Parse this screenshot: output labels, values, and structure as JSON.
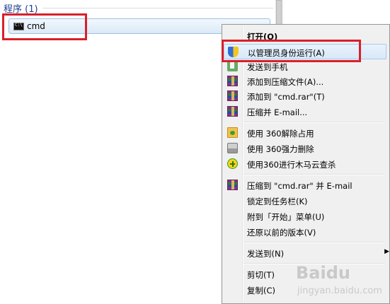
{
  "results": {
    "section_header": "程序 (1)",
    "items": [
      {
        "label": "cmd",
        "icon": "cmd-icon"
      }
    ]
  },
  "context_menu": {
    "items": [
      {
        "label": "打开(O)",
        "bold": true,
        "icon": null
      },
      {
        "label": "以管理员身份运行(A)",
        "icon": "uac-shield-icon",
        "highlighted": true
      },
      {
        "label": "发送到手机",
        "icon": "phone-icon"
      },
      {
        "label": "添加到压缩文件(A)...",
        "icon": "winrar-icon"
      },
      {
        "label": "添加到 \"cmd.rar\"(T)",
        "icon": "winrar-icon"
      },
      {
        "label": "压缩并 E-mail...",
        "icon": "winrar-icon"
      },
      {
        "label": "使用 360解除占用",
        "icon": "360-unlock-icon"
      },
      {
        "label": "使用 360强力删除",
        "icon": "360-shred-icon"
      },
      {
        "label": "使用360进行木马云查杀",
        "icon": "360-scan-icon"
      },
      {
        "label": "压缩到 \"cmd.rar\" 并 E-mail",
        "icon": "winrar-icon"
      },
      {
        "label": "锁定到任务栏(K)",
        "icon": null
      },
      {
        "label": "附到「开始」菜单(U)",
        "icon": null
      },
      {
        "label": "还原以前的版本(V)",
        "icon": null
      },
      {
        "label": "发送到(N)",
        "icon": null,
        "submenu": true
      },
      {
        "label": "剪切(T)",
        "icon": null
      },
      {
        "label": "复制(C)",
        "icon": null
      }
    ]
  },
  "watermark": {
    "text": "Baidu",
    "subtext": "jingyan.baidu.com"
  },
  "annotation_color": "#d8202a"
}
